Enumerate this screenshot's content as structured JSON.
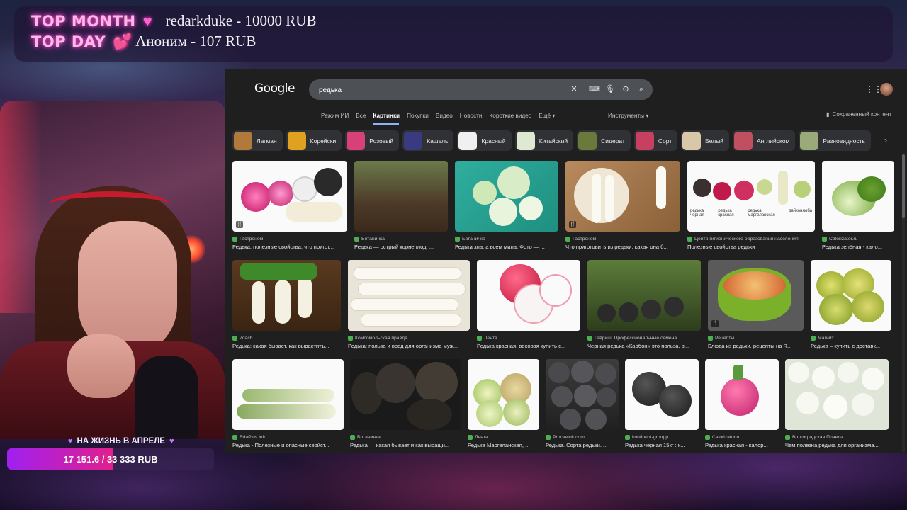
{
  "overlay": {
    "top_month_label": "TOP MONTH",
    "top_month_value": "redarkduke - 10000 RUB",
    "top_day_label": "TOP DAY",
    "top_day_value": "Аноним - 107 RUB",
    "goal_label": "НА ЖИЗНЬ В АПРЕЛЕ",
    "goal_text": "17 151.6 / 33 333 RUB",
    "goal_progress": 0.515,
    "accent_pink": "#ff5fd0",
    "accent_purple": "#a020f0"
  },
  "browser": {
    "logo": "Google",
    "search_value": "редька",
    "tabs": [
      "Режим ИИ",
      "Все",
      "Картинки",
      "Покупки",
      "Видео",
      "Новости",
      "Короткие видео",
      "Ещё ▾"
    ],
    "active_tab": "Картинки",
    "tools_label": "Инструменты ▾",
    "saved_label": "Сохраненный контент",
    "chips": [
      "Лагман",
      "Корейски",
      "Розовый",
      "Кашель",
      "Красный",
      "Китайский",
      "Сидерат",
      "Сорт",
      "Белый",
      "Английском",
      "Разновидность"
    ],
    "results": [
      [
        {
          "source": "Гастроном",
          "title": "Редька: полезные свойства, что пригот..."
        },
        {
          "source": "Ботаничка",
          "title": "Редька — острый корнеплод. ..."
        },
        {
          "source": "Ботаничка",
          "title": "Редька зла, а всем мила. Фото — ..."
        },
        {
          "source": "Гастроном",
          "title": "Что приготовить из редьки, какая она б..."
        },
        {
          "source": "Центр гигиенического образования населения",
          "title": "Полезные свойства редьки"
        },
        {
          "source": "Calorizator.ru",
          "title": "Редька зелёная - кало..."
        }
      ],
      [
        {
          "source": "7dach",
          "title": "Редька: какая бывает, как выраститъ..."
        },
        {
          "source": "Комсомольская правда",
          "title": "Редька: польза и вред для организма муж..."
        },
        {
          "source": "Лента",
          "title": "Редька красная, весовая купить с..."
        },
        {
          "source": "Гавриш. Профессиональные семена",
          "title": "Черная редька «Карбон» это польза, в..."
        },
        {
          "source": "Рецепты",
          "title": "Блюда из редьки, рецепты на R..."
        },
        {
          "source": "Магнит",
          "title": "Редька – купить с доставк..."
        }
      ],
      [
        {
          "source": "EdaPlus.info",
          "title": "Редька - Полезные и опасные свойст..."
        },
        {
          "source": "Ботаничка",
          "title": "Редька — какая бывает и как выращи..."
        },
        {
          "source": "Лента",
          "title": "Редька Маргеланская, ..."
        },
        {
          "source": "Procvetok.com",
          "title": "Редька. Сорта редьки. ..."
        },
        {
          "source": "kontinent-groupp",
          "title": "Редька черная 15кг : к..."
        },
        {
          "source": "Calorizator.ru",
          "title": "Редька красная - калор..."
        },
        {
          "source": "Волгоградская Правда",
          "title": "Чем полезна редька для организма..."
        }
      ]
    ],
    "image_labels": {
      "r1c5": [
        "редька черная",
        "редька красная",
        "редька маргеланская",
        "дайкон",
        "лоба"
      ]
    }
  }
}
